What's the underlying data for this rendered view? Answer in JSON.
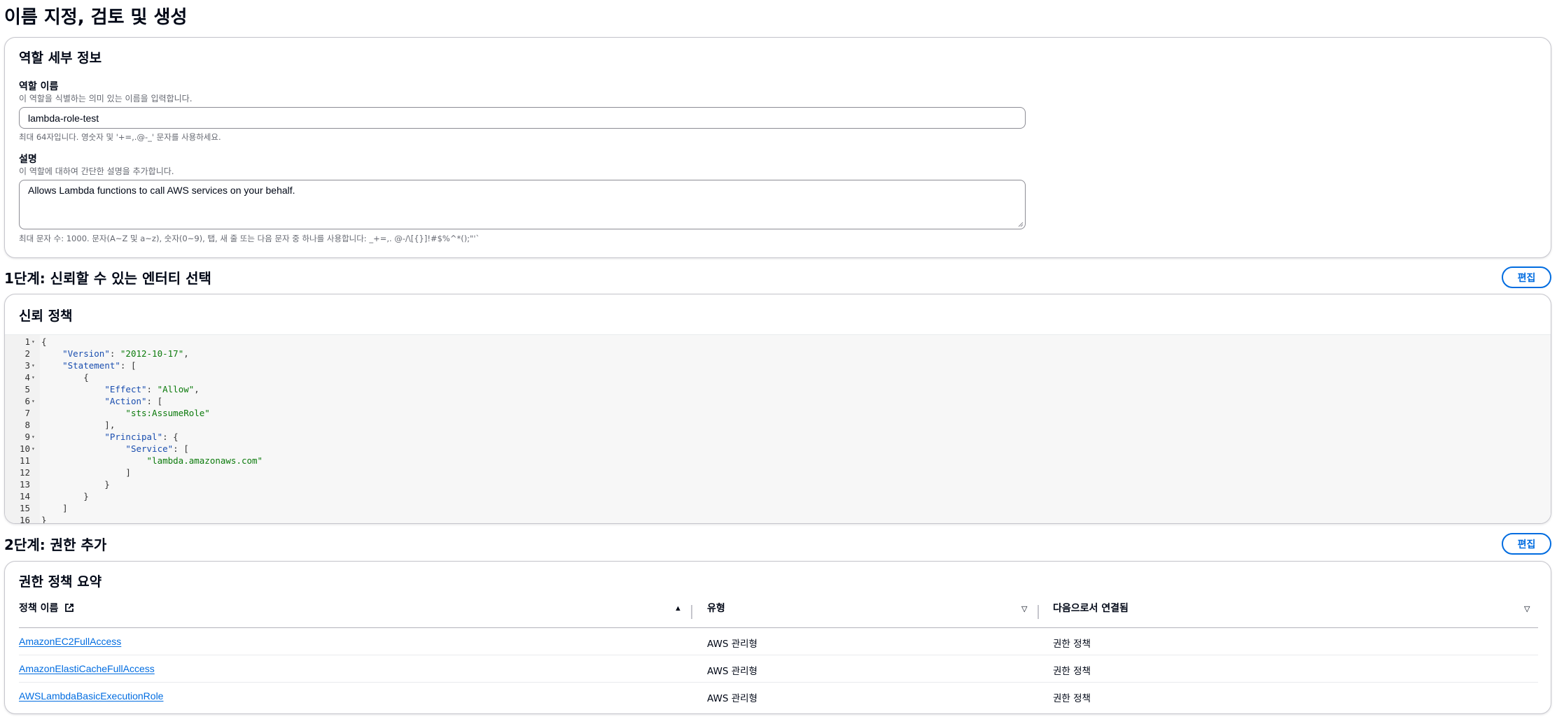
{
  "page": {
    "title": "이름 지정, 검토 및 생성"
  },
  "role_details": {
    "title": "역할 세부 정보",
    "name_label": "역할 이름",
    "name_desc": "이 역할을 식별하는 의미 있는 이름을 입력합니다.",
    "name_value": "lambda-role-test",
    "name_hint": "최대 64자입니다. 영숫자 및 '+=,.@-_' 문자를 사용하세요.",
    "desc_label": "설명",
    "desc_desc": "이 역할에 대하여 간단한 설명을 추가합니다.",
    "desc_value": "Allows Lambda functions to call AWS services on your behalf.",
    "desc_hint": "최대 문자 수: 1000. 문자(A~Z 및 a~z), 숫자(0~9), 탭, 새 줄 또는 다음 문자 중 하나를 사용합니다: _+=,. @-/\\[{}]!#$%^*();\"'`"
  },
  "step1": {
    "heading": "1단계: 신뢰할 수 있는 엔터티 선택",
    "edit_label": "편집",
    "card_title": "신뢰 정책",
    "code_lines": [
      {
        "n": "1",
        "fold": true,
        "text": "{"
      },
      {
        "n": "2",
        "fold": false,
        "text": "    \"Version\": \"2012-10-17\","
      },
      {
        "n": "3",
        "fold": true,
        "text": "    \"Statement\": ["
      },
      {
        "n": "4",
        "fold": true,
        "text": "        {"
      },
      {
        "n": "5",
        "fold": false,
        "text": "            \"Effect\": \"Allow\","
      },
      {
        "n": "6",
        "fold": true,
        "text": "            \"Action\": ["
      },
      {
        "n": "7",
        "fold": false,
        "text": "                \"sts:AssumeRole\""
      },
      {
        "n": "8",
        "fold": false,
        "text": "            ],"
      },
      {
        "n": "9",
        "fold": true,
        "text": "            \"Principal\": {"
      },
      {
        "n": "10",
        "fold": true,
        "text": "                \"Service\": ["
      },
      {
        "n": "11",
        "fold": false,
        "text": "                    \"lambda.amazonaws.com\""
      },
      {
        "n": "12",
        "fold": false,
        "text": "                ]"
      },
      {
        "n": "13",
        "fold": false,
        "text": "            }"
      },
      {
        "n": "14",
        "fold": false,
        "text": "        }"
      },
      {
        "n": "15",
        "fold": false,
        "text": "    ]"
      },
      {
        "n": "16",
        "fold": false,
        "text": "}"
      }
    ]
  },
  "step2": {
    "heading": "2단계: 권한 추가",
    "edit_label": "편집",
    "card_title": "권한 정책 요약",
    "columns": [
      "정책 이름",
      "유형",
      "다음으로서 연결됨"
    ],
    "rows": [
      {
        "name": "AmazonEC2FullAccess",
        "type": "AWS 관리형",
        "attached": "권한 정책"
      },
      {
        "name": "AmazonElastiCacheFullAccess",
        "type": "AWS 관리형",
        "attached": "권한 정책"
      },
      {
        "name": "AWSLambdaBasicExecutionRole",
        "type": "AWS 관리형",
        "attached": "권한 정책"
      }
    ]
  },
  "icons": {
    "external_link": "external-link-icon",
    "sort_asc": "caret-up-filled-icon",
    "sort_desc": "caret-down-icon",
    "fold": "fold-caret-icon"
  },
  "colors": {
    "link": "#006ce0",
    "json_key": "#1a4eaf",
    "json_string": "#0b7a0b",
    "border": "#c6c6cd"
  }
}
